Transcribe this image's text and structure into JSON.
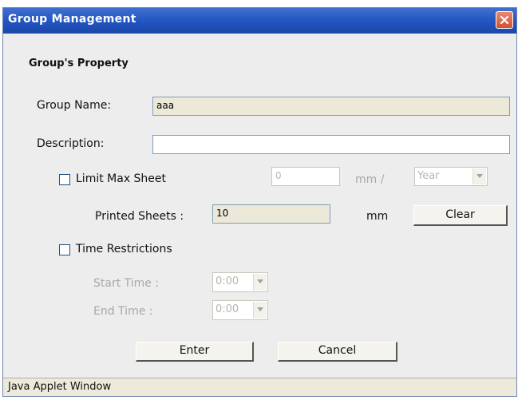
{
  "window": {
    "title": "Group Management"
  },
  "section": {
    "title": "Group's Property"
  },
  "group_name": {
    "label": "Group Name:",
    "value": "aaa"
  },
  "description": {
    "label": "Description:",
    "value": ""
  },
  "limit": {
    "checkbox_label": "Limit Max Sheet",
    "value": "0",
    "unit": "mm /",
    "period_selected": "Year",
    "checked": false
  },
  "printed": {
    "label": "Printed Sheets :",
    "value": "10",
    "unit": "mm",
    "clear_label": "Clear"
  },
  "time": {
    "checkbox_label": "Time Restrictions",
    "checked": false,
    "start_label": "Start Time :",
    "start_value": "0:00",
    "end_label": "End Time :",
    "end_value": "0:00"
  },
  "buttons": {
    "enter": "Enter",
    "cancel": "Cancel"
  },
  "status": {
    "text": "Java Applet Window"
  },
  "icons": {
    "close": "close-icon",
    "dropdown": "chevron-down-icon"
  }
}
